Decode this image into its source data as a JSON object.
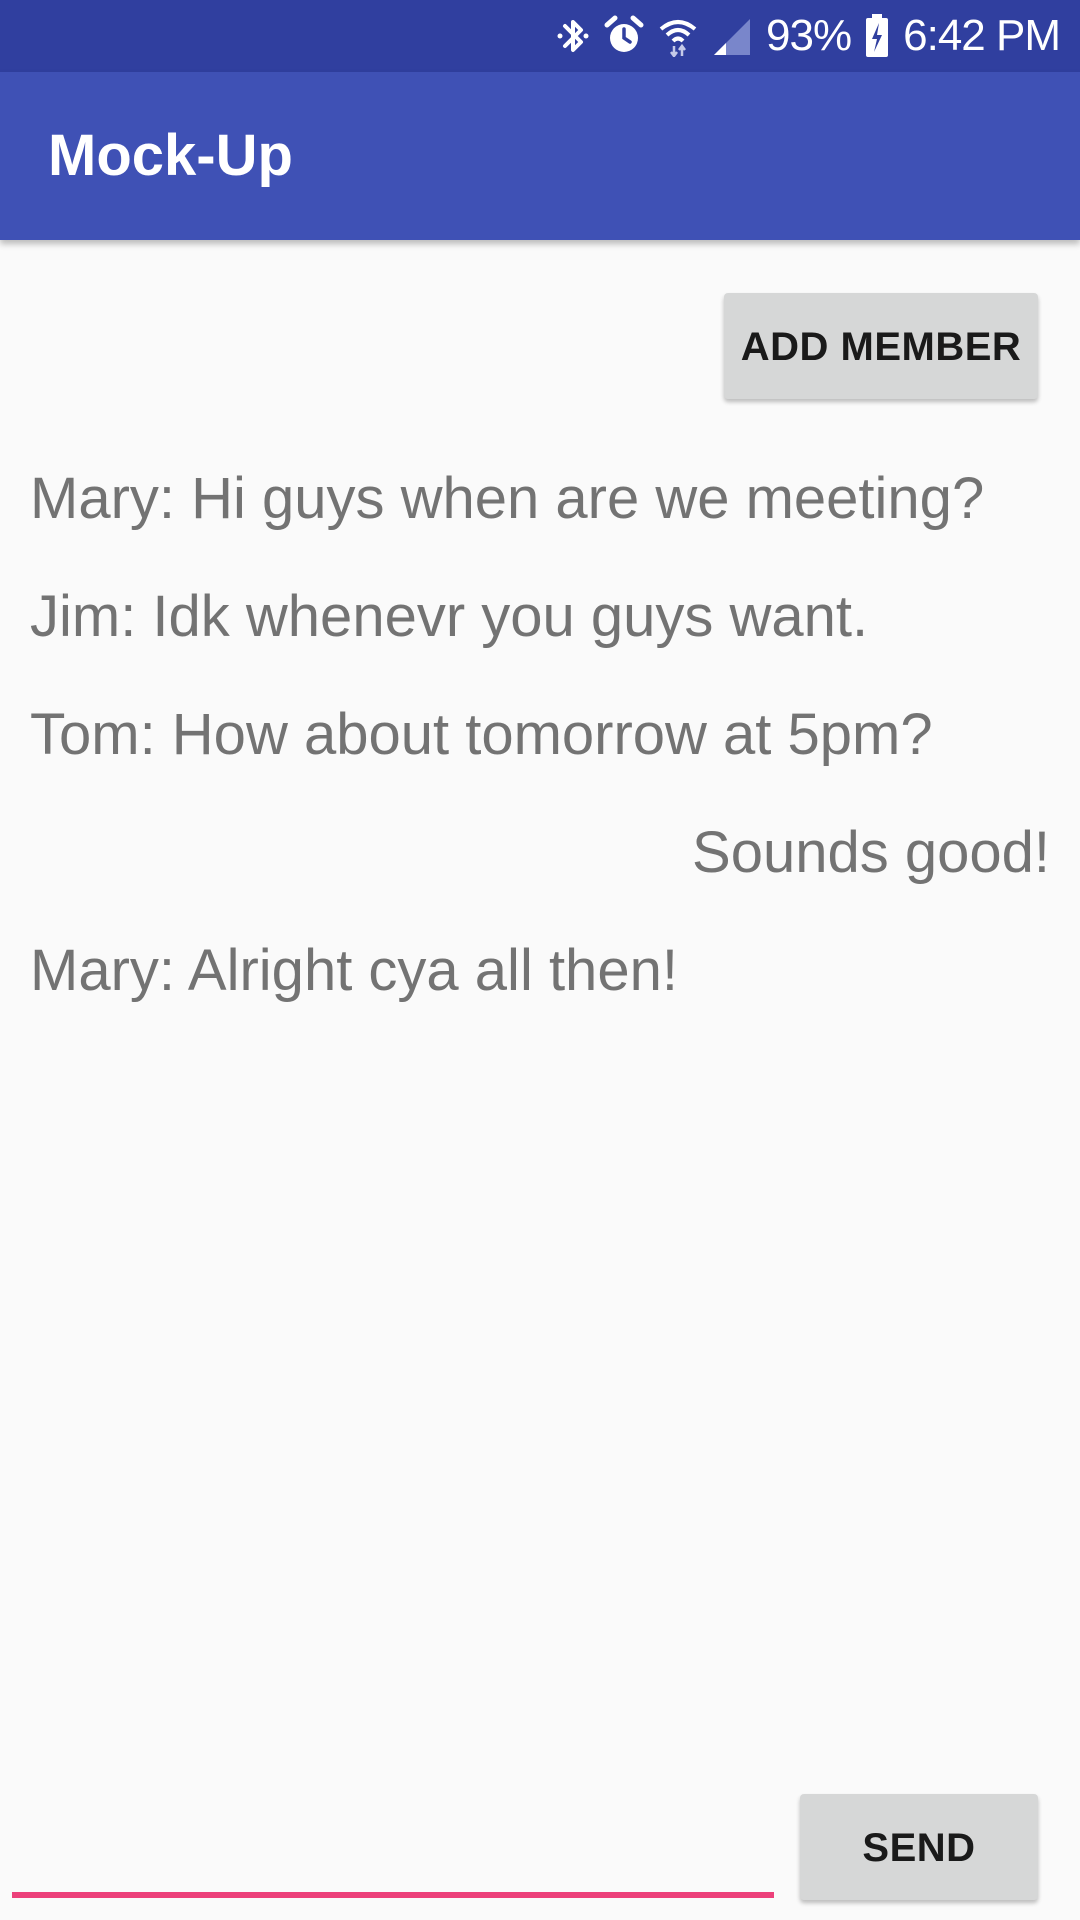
{
  "status_bar": {
    "battery": "93%",
    "time": "6:42 PM",
    "icons": [
      "bluetooth-icon",
      "alarm-icon",
      "wifi-icon",
      "signal-icon",
      "battery-icon"
    ]
  },
  "app_bar": {
    "title": "Mock-Up",
    "color": "#3f51b5"
  },
  "toolbar": {
    "add_member_label": "ADD MEMBER"
  },
  "messages": [
    {
      "text": "Mary: Hi guys when are we meeting?",
      "align": "left"
    },
    {
      "text": "Jim: Idk whenevr you guys want.",
      "align": "left"
    },
    {
      "text": "Tom: How about tomorrow at 5pm?",
      "align": "left"
    },
    {
      "text": "Sounds good!",
      "align": "right"
    },
    {
      "text": "Mary: Alright cya all then!",
      "align": "left"
    }
  ],
  "composer": {
    "value": "",
    "placeholder": "",
    "send_label": "SEND",
    "accent": "#ec407a"
  }
}
